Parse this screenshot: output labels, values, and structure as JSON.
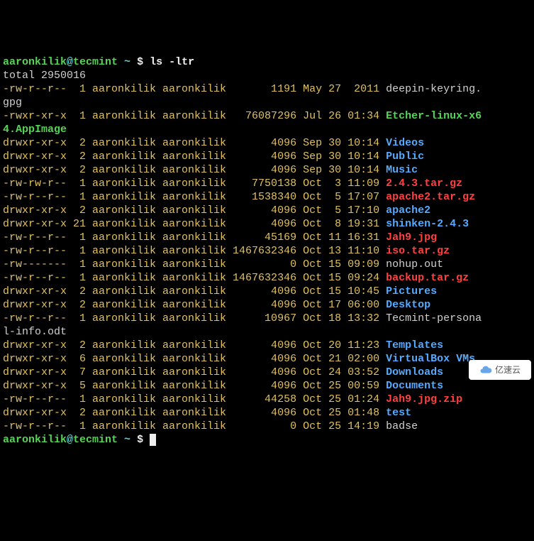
{
  "prompt": {
    "user": "aaronkilik",
    "host": "tecmint",
    "sep1": "@",
    "path": " ~ ",
    "dollar": "$ ",
    "cmd": "ls -ltr"
  },
  "total_line": "total 2950016",
  "rows": [
    {
      "perm": "-rw-r--r--",
      "links": " 1",
      "owner": "aaronkilik",
      "group": "aaronkilik",
      "size": "      1191",
      "date": "May 27  2011",
      "name": "deepin-keyring.gpg",
      "cls": "white",
      "wrap": true
    },
    {
      "perm": "-rwxr-xr-x",
      "links": " 1",
      "owner": "aaronkilik",
      "group": "aaronkilik",
      "size": "  76087296",
      "date": "Jul 26 01:34",
      "name": "Etcher-linux-x64.AppImage",
      "cls": "green",
      "wrap": true
    },
    {
      "perm": "drwxr-xr-x",
      "links": " 2",
      "owner": "aaronkilik",
      "group": "aaronkilik",
      "size": "      4096",
      "date": "Sep 30 10:14",
      "name": "Videos",
      "cls": "blue",
      "wrap": false
    },
    {
      "perm": "drwxr-xr-x",
      "links": " 2",
      "owner": "aaronkilik",
      "group": "aaronkilik",
      "size": "      4096",
      "date": "Sep 30 10:14",
      "name": "Public",
      "cls": "blue",
      "wrap": false
    },
    {
      "perm": "drwxr-xr-x",
      "links": " 2",
      "owner": "aaronkilik",
      "group": "aaronkilik",
      "size": "      4096",
      "date": "Sep 30 10:14",
      "name": "Music",
      "cls": "blue",
      "wrap": false
    },
    {
      "perm": "-rw-rw-r--",
      "links": " 1",
      "owner": "aaronkilik",
      "group": "aaronkilik",
      "size": "   7750138",
      "date": "Oct  3 11:09",
      "name": "2.4.3.tar.gz",
      "cls": "red",
      "wrap": false
    },
    {
      "perm": "-rw-r--r--",
      "links": " 1",
      "owner": "aaronkilik",
      "group": "aaronkilik",
      "size": "   1538340",
      "date": "Oct  5 17:07",
      "name": "apache2.tar.gz",
      "cls": "red",
      "wrap": false
    },
    {
      "perm": "drwxr-xr-x",
      "links": " 2",
      "owner": "aaronkilik",
      "group": "aaronkilik",
      "size": "      4096",
      "date": "Oct  5 17:10",
      "name": "apache2",
      "cls": "blue",
      "wrap": false
    },
    {
      "perm": "drwxr-xr-x",
      "links": "21",
      "owner": "aaronkilik",
      "group": "aaronkilik",
      "size": "      4096",
      "date": "Oct  8 19:31",
      "name": "shinken-2.4.3",
      "cls": "blue",
      "wrap": false
    },
    {
      "perm": "-rw-r--r--",
      "links": " 1",
      "owner": "aaronkilik",
      "group": "aaronkilik",
      "size": "     45169",
      "date": "Oct 11 16:31",
      "name": "Jah9.jpg",
      "cls": "red",
      "wrap": false
    },
    {
      "perm": "-rw-r--r--",
      "links": " 1",
      "owner": "aaronkilik",
      "group": "aaronkilik",
      "size": "1467632346",
      "date": "Oct 13 11:10",
      "name": "iso.tar.gz",
      "cls": "red",
      "wrap": false
    },
    {
      "perm": "-rw-------",
      "links": " 1",
      "owner": "aaronkilik",
      "group": "aaronkilik",
      "size": "         0",
      "date": "Oct 15 09:09",
      "name": "nohup.out",
      "cls": "white",
      "wrap": false
    },
    {
      "perm": "-rw-r--r--",
      "links": " 1",
      "owner": "aaronkilik",
      "group": "aaronkilik",
      "size": "1467632346",
      "date": "Oct 15 09:24",
      "name": "backup.tar.gz",
      "cls": "red",
      "wrap": false
    },
    {
      "perm": "drwxr-xr-x",
      "links": " 2",
      "owner": "aaronkilik",
      "group": "aaronkilik",
      "size": "      4096",
      "date": "Oct 15 10:45",
      "name": "Pictures",
      "cls": "blue",
      "wrap": false
    },
    {
      "perm": "drwxr-xr-x",
      "links": " 2",
      "owner": "aaronkilik",
      "group": "aaronkilik",
      "size": "      4096",
      "date": "Oct 17 06:00",
      "name": "Desktop",
      "cls": "blue",
      "wrap": false
    },
    {
      "perm": "-rw-r--r--",
      "links": " 1",
      "owner": "aaronkilik",
      "group": "aaronkilik",
      "size": "     10967",
      "date": "Oct 18 13:32",
      "name": "Tecmint-personal-info.odt",
      "cls": "white",
      "wrap": true
    },
    {
      "perm": "drwxr-xr-x",
      "links": " 2",
      "owner": "aaronkilik",
      "group": "aaronkilik",
      "size": "      4096",
      "date": "Oct 20 11:23",
      "name": "Templates",
      "cls": "blue",
      "wrap": false
    },
    {
      "perm": "drwxr-xr-x",
      "links": " 6",
      "owner": "aaronkilik",
      "group": "aaronkilik",
      "size": "      4096",
      "date": "Oct 21 02:00",
      "name": "VirtualBox VMs",
      "cls": "blue",
      "wrap": false
    },
    {
      "perm": "drwxr-xr-x",
      "links": " 7",
      "owner": "aaronkilik",
      "group": "aaronkilik",
      "size": "      4096",
      "date": "Oct 24 03:52",
      "name": "Downloads",
      "cls": "blue",
      "wrap": false
    },
    {
      "perm": "drwxr-xr-x",
      "links": " 5",
      "owner": "aaronkilik",
      "group": "aaronkilik",
      "size": "      4096",
      "date": "Oct 25 00:59",
      "name": "Documents",
      "cls": "blue",
      "wrap": false
    },
    {
      "perm": "-rw-r--r--",
      "links": " 1",
      "owner": "aaronkilik",
      "group": "aaronkilik",
      "size": "     44258",
      "date": "Oct 25 01:24",
      "name": "Jah9.jpg.zip",
      "cls": "red",
      "wrap": false
    },
    {
      "perm": "drwxr-xr-x",
      "links": " 2",
      "owner": "aaronkilik",
      "group": "aaronkilik",
      "size": "      4096",
      "date": "Oct 25 01:48",
      "name": "test",
      "cls": "blue",
      "wrap": false
    },
    {
      "perm": "-rw-r--r--",
      "links": " 1",
      "owner": "aaronkilik",
      "group": "aaronkilik",
      "size": "         0",
      "date": "Oct 25 14:19",
      "name": "badse",
      "cls": "white",
      "wrap": false
    }
  ],
  "cols": {
    "cut": 15
  },
  "watermark": "亿速云"
}
